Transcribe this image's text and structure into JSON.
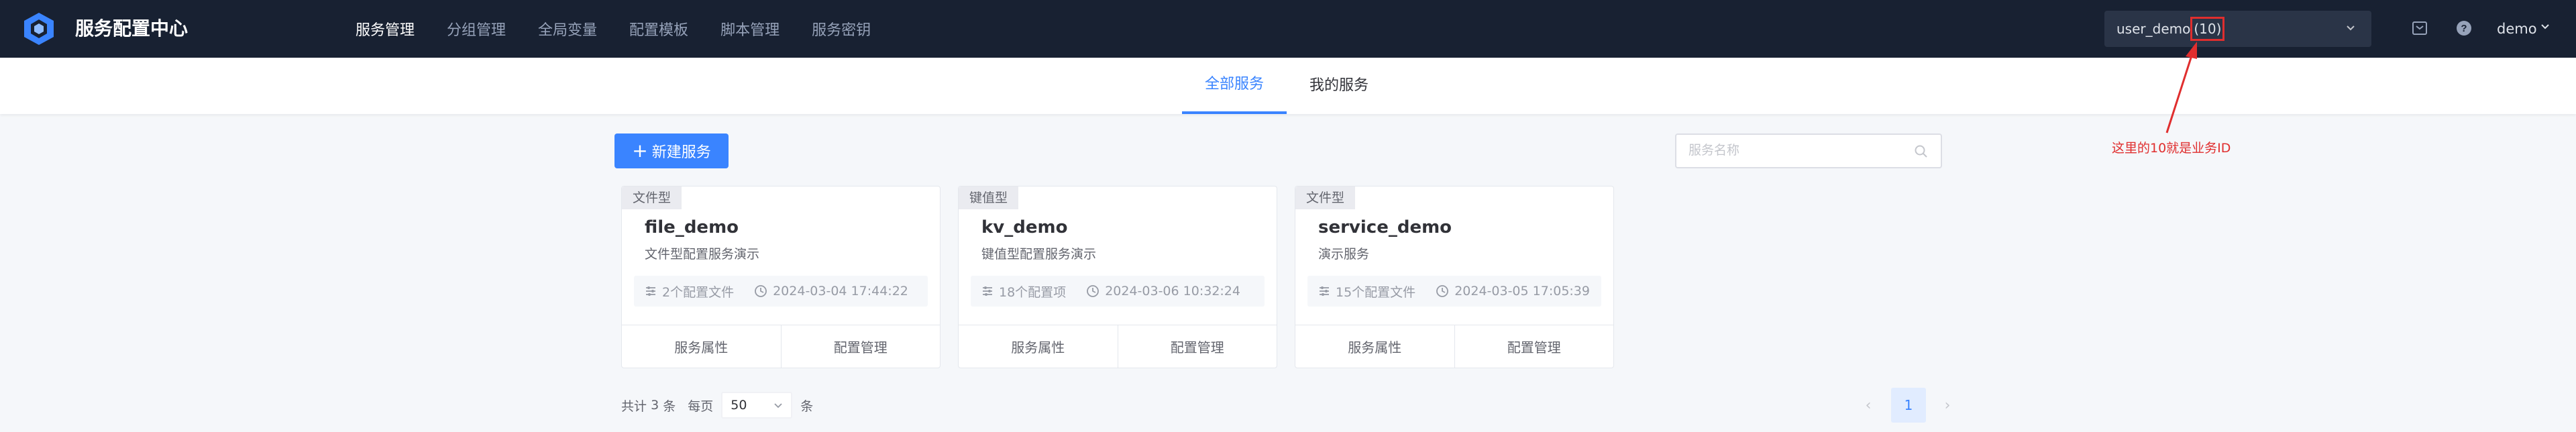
{
  "app": {
    "title": "服务配置中心"
  },
  "nav": {
    "items": [
      {
        "label": "服务管理",
        "active": true
      },
      {
        "label": "分组管理",
        "active": false
      },
      {
        "label": "全局变量",
        "active": false
      },
      {
        "label": "配置模板",
        "active": false
      },
      {
        "label": "脚本管理",
        "active": false
      },
      {
        "label": "服务密钥",
        "active": false
      }
    ]
  },
  "biz": {
    "name": "user_demo",
    "id": "(10)"
  },
  "user": {
    "name": "demo"
  },
  "tabs": [
    {
      "label": "全部服务",
      "active": true
    },
    {
      "label": "我的服务",
      "active": false
    }
  ],
  "annotation": {
    "text": "这里的10就是业务ID",
    "color": "#e02e2e"
  },
  "toolbar": {
    "new_button_label": "新建服务",
    "search_placeholder": "服务名称",
    "search_value": ""
  },
  "services": [
    {
      "type": "文件型",
      "name": "file_demo",
      "desc": "文件型配置服务演示",
      "count": "2个配置文件",
      "time": "2024-03-04 17:44:22",
      "action1": "服务属性",
      "action2": "配置管理"
    },
    {
      "type": "键值型",
      "name": "kv_demo",
      "desc": "键值型配置服务演示",
      "count": "18个配置项",
      "time": "2024-03-06 10:32:24",
      "action1": "服务属性",
      "action2": "配置管理"
    },
    {
      "type": "文件型",
      "name": "service_demo",
      "desc": "演示服务",
      "count": "15个配置文件",
      "time": "2024-03-05 17:05:39",
      "action1": "服务属性",
      "action2": "配置管理"
    }
  ],
  "pagination": {
    "total_prefix": "共计",
    "total": "3",
    "total_suffix": "条",
    "per_page_label": "每页",
    "page_size": "50",
    "page_size_suffix": "条",
    "current_page": "1",
    "prev": "‹",
    "next": "›"
  },
  "colors": {
    "primary": "#3a84ff",
    "header_bg": "#182132",
    "annotation": "#e02e2e"
  },
  "icons": [
    "logo-icon",
    "chevron-down-icon",
    "doc-center-icon",
    "help-icon",
    "search-icon",
    "config-list-icon",
    "clock-icon"
  ]
}
